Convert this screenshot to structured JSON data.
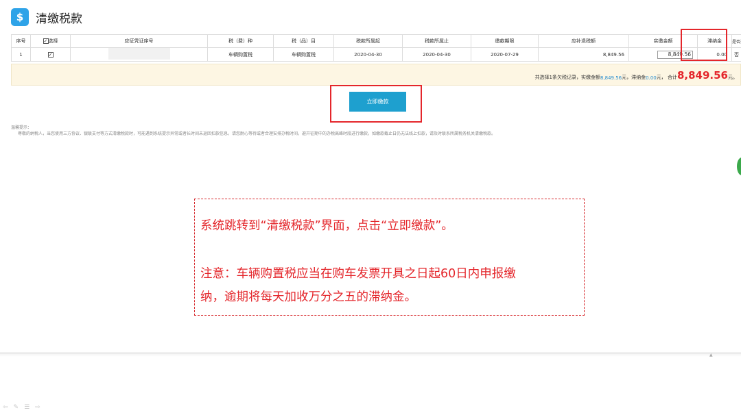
{
  "header": {
    "icon": "money-bag-icon",
    "title": "清缴税款"
  },
  "table": {
    "headers": [
      "序号",
      "选择",
      "应征凭证序号",
      "税（费）种",
      "税（品）目",
      "税款所属起",
      "税款所属止",
      "缴款期限",
      "应补退税额",
      "实缴金额",
      "滞纳金",
      "是否逾期"
    ],
    "rows": [
      {
        "index": "1",
        "checked": true,
        "voucher": "",
        "tax_type": "车辆购置税",
        "tax_item": "车辆购置税",
        "period_start": "2020-04-30",
        "period_end": "2020-04-30",
        "deadline": "2020-07-29",
        "amount_due": "8,849.56",
        "paid_amount": "8,849.56",
        "late_fee": "0.00",
        "overdue": "否"
      }
    ]
  },
  "summary": {
    "text1": "共选择1条欠税记录，实缴金额",
    "paid": "8,849.56",
    "text2": " 元，滞纳金 ",
    "late_fee": "0.00",
    "text3": "元， 合计",
    "total": "8,849.56",
    "text4": "元。"
  },
  "pay_button": {
    "label": "立即缴款"
  },
  "tips": {
    "title": "温馨提示：",
    "body": "尊敬的纳税人，当您使用三方协议、银联支付等方式清缴税款时，可能遇到系统提示异常或者长时间未返回扣款信息，请您耐心等待或者合理安排办税时间，避开征期中的办税高峰时段进行缴款，如缴款截止日仍无法线上扣款，请及时联系所属税务机关清缴税款。"
  },
  "annotation": {
    "line1": "系统跳转到“清缴税款”界面，点击“立即缴款”。",
    "line2": "注意：车辆购置税应当在购车发票开具之日起60日内申报缴",
    "line3": "纳，逾期将每天加收万分之五的滞纳金。"
  },
  "colors": {
    "accent": "#1ea0cf",
    "highlight": "#e4262b",
    "summary_bg": "#fdf6e3"
  }
}
